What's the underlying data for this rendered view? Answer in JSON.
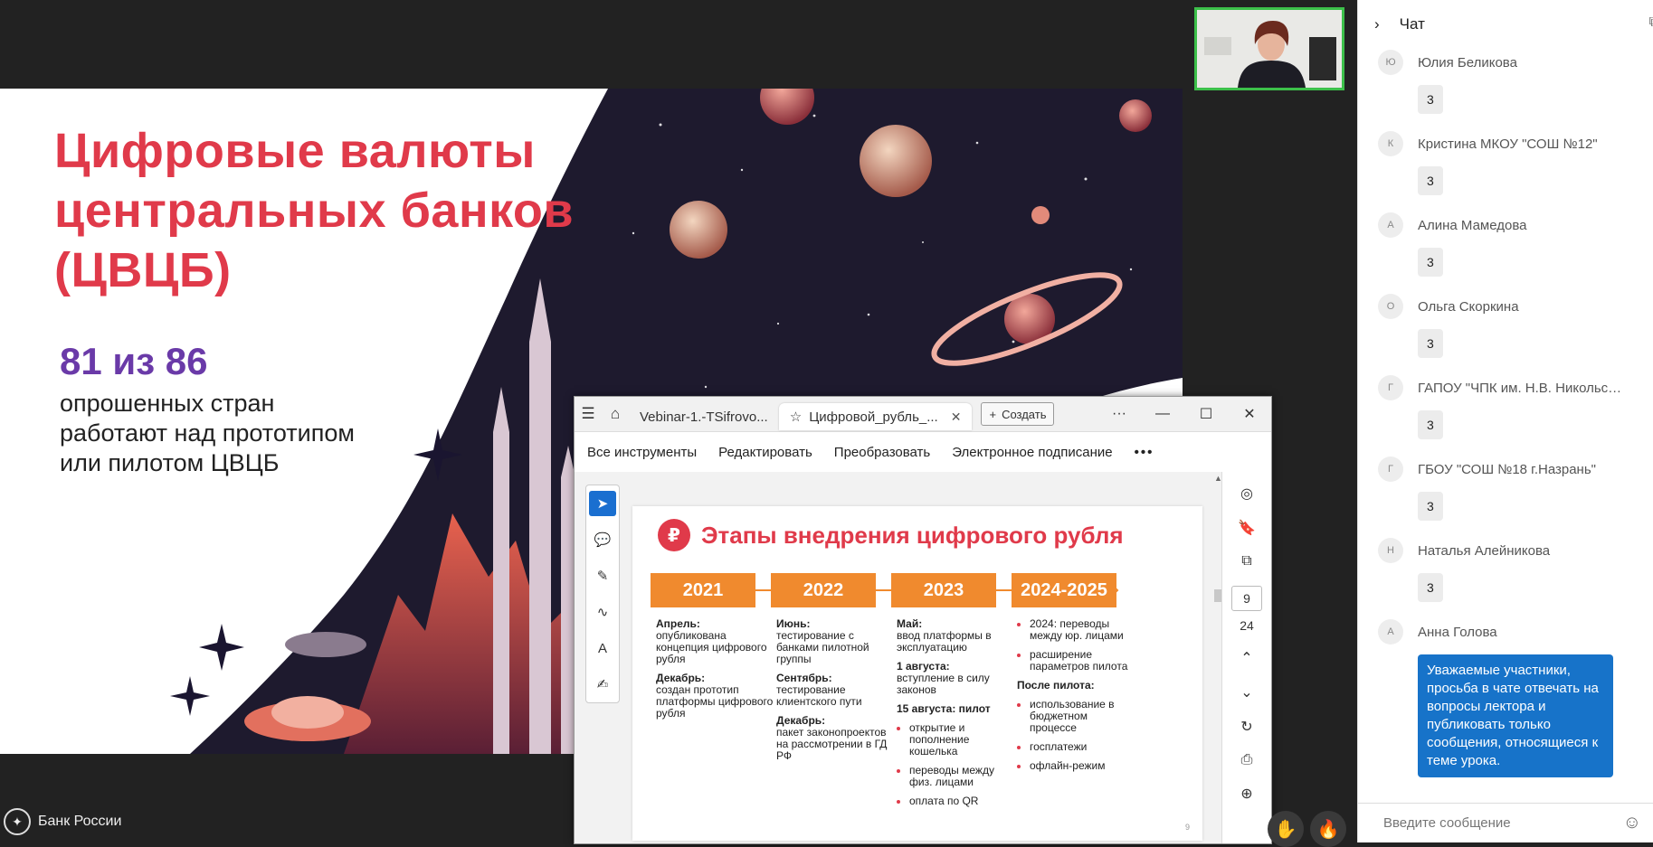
{
  "slide": {
    "title": "Цифровые валюты центральных банков (ЦВЦБ)",
    "stat": "81 из 86",
    "description": "опрошенных стран работают над прототипом или пилотом ЦВЦБ"
  },
  "footer": {
    "logo_text": "Банк России",
    "logo_icon": "eagle-emblem-icon"
  },
  "pdf": {
    "tabs": [
      {
        "label": "Vebinar-1.-TSifrovo...",
        "active": false
      },
      {
        "label": "Цифровой_рубль_...",
        "active": true
      }
    ],
    "create_label": "Создать",
    "menu": [
      "Все инструменты",
      "Редактировать",
      "Преобразовать",
      "Электронное подписание"
    ],
    "page_current": "9",
    "page_total": "24",
    "page_content": {
      "title": "Этапы внедрения цифрового рубля",
      "rouble_glyph": "₽",
      "years": [
        "2021",
        "2022",
        "2023",
        "2024-2025"
      ],
      "col1": {
        "h1": "Апрель:",
        "t1": "опубликована концепция цифрового рубля",
        "h2": "Декабрь:",
        "t2": "создан прототип платформы цифрового рубля"
      },
      "col2": {
        "h1": "Июнь:",
        "t1": "тестирование с банками пилотной группы",
        "h2": "Сентябрь:",
        "t2": "тестирование клиентского пути",
        "h3": "Декабрь:",
        "t3": "пакет законопроектов на рассмотрении в ГД РФ"
      },
      "col3": {
        "h1": "Май:",
        "t1": "ввод платформы в эксплуатацию",
        "h2": "1 августа:",
        "t2": "вступление в силу законов",
        "h3": "15 августа: пилот",
        "items": [
          "открытие и пополнение кошелька",
          "переводы между физ. лицами",
          "оплата по QR"
        ]
      },
      "col4": {
        "items_a": [
          "2024: переводы между юр. лицами",
          "расширение параметров пилота"
        ],
        "h1": "После пилота:",
        "items_b": [
          "использование в бюджетном процессе",
          "госплатежи",
          "офлайн-режим"
        ]
      },
      "page_number": "9"
    }
  },
  "chat": {
    "title": "Чат",
    "messages": [
      {
        "initial": "Ю",
        "sender": "Юлия Беликова",
        "text": "3"
      },
      {
        "initial": "К",
        "sender": "Кристина МКОУ \"СОШ №12\"",
        "text": "3"
      },
      {
        "initial": "А",
        "sender": "Алина Мамедова",
        "text": "3"
      },
      {
        "initial": "О",
        "sender": "Ольга Скоркина",
        "text": "3"
      },
      {
        "initial": "Г",
        "sender": "ГАПОУ \"ЧПК им. Н.В. Никольско...",
        "text": "3"
      },
      {
        "initial": "Г",
        "sender": "ГБОУ \"СОШ №18 г.Назрань\"",
        "text": "3"
      },
      {
        "initial": "Н",
        "sender": "Наталья Алейникова",
        "text": "3"
      },
      {
        "initial": "А",
        "sender": "Анна Голова",
        "text": "Уважаемые участники, просьба в чате отвечать на вопросы лектора и публиковать только сообщения, относящиеся к теме урока."
      }
    ],
    "input_placeholder": "Введите сообщение"
  },
  "colors": {
    "accent_red": "#e03a4a",
    "accent_orange": "#f08a2e",
    "accent_purple": "#6a3aa8",
    "chat_blue": "#1773c9",
    "video_border": "#3cc04a"
  }
}
